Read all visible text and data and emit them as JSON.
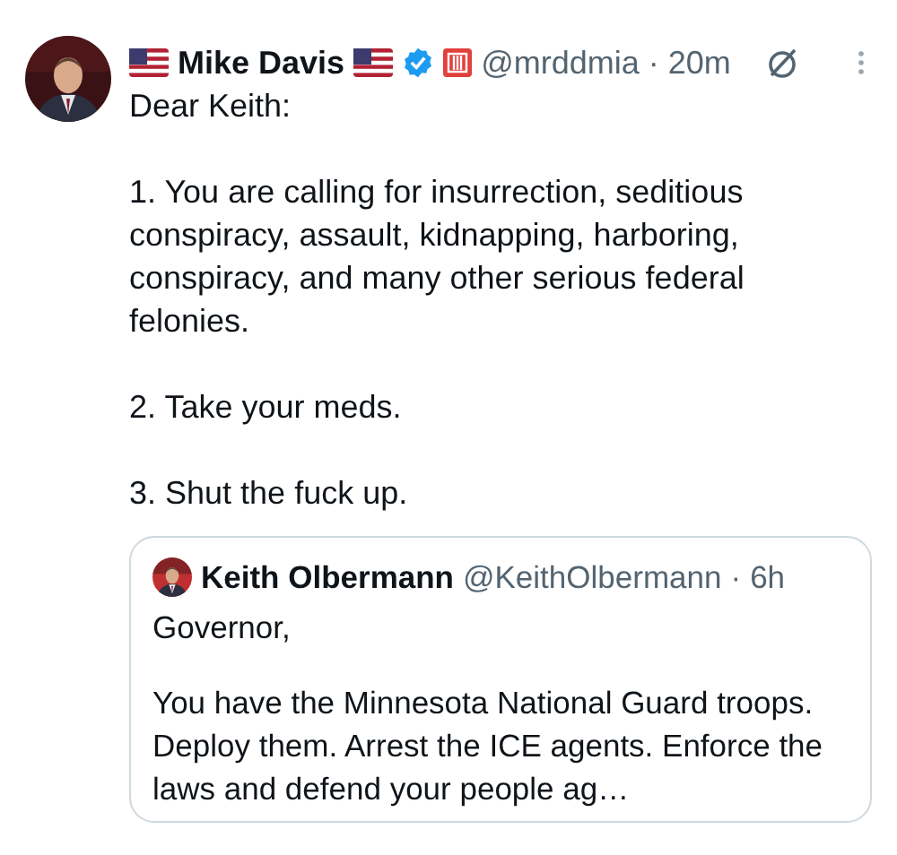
{
  "post": {
    "author_name": "Mike Davis",
    "handle": "@mrddmia",
    "separator": "·",
    "time": "20m",
    "paragraphs": [
      "Dear Keith:",
      "1. You are calling for insurrection, seditious conspiracy, assault, kidnapping, harboring, conspiracy, and many other serious federal felonies.",
      "2. Take your meds.",
      "3. Shut the fuck up."
    ],
    "quote": {
      "author_name": "Keith Olbermann",
      "handle": "@KeithOlbermann",
      "separator": "·",
      "time": "6h",
      "paragraphs": [
        "Governor,",
        "You have the Minnesota National Guard troops. Deploy them. Arrest the ICE agents. Enforce the laws and defend your people ag…"
      ]
    }
  }
}
